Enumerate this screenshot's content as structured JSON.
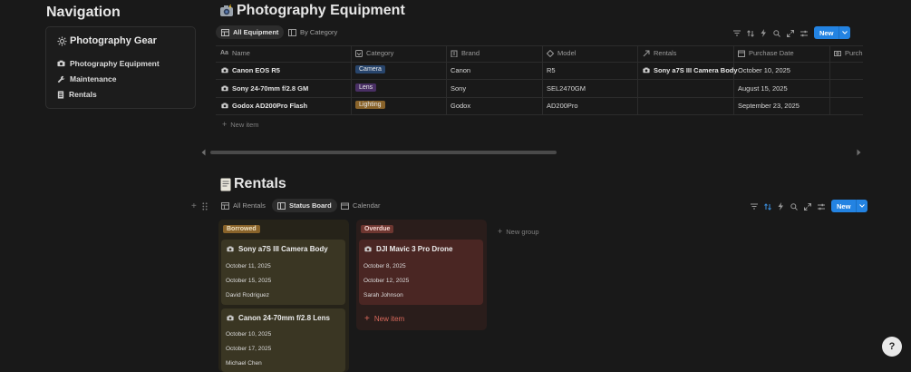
{
  "navigation": {
    "title": "Navigation",
    "card_title": "Photography Gear",
    "items": [
      {
        "label": "Photography Equipment",
        "icon": "camera-icon"
      },
      {
        "label": "Maintenance",
        "icon": "wrench-icon"
      },
      {
        "label": "Rentals",
        "icon": "receipt-icon"
      }
    ]
  },
  "equipment": {
    "title": "Photography Equipment",
    "tabs": [
      "All Equipment",
      "By Category"
    ],
    "new_label": "New",
    "columns": [
      "Name",
      "Category",
      "Brand",
      "Model",
      "Rentals",
      "Purchase Date",
      "Purcha"
    ],
    "rows": [
      {
        "name": "Canon EOS R5",
        "category": "Camera",
        "category_color": "#28456c",
        "brand": "Canon",
        "model": "R5",
        "rentals": "Sony a7S III Camera Body",
        "purchase_date": "October 10, 2025"
      },
      {
        "name": "Sony 24-70mm f/2.8 GM",
        "category": "Lens",
        "category_color": "#492f64",
        "brand": "Sony",
        "model": "SEL2470GM",
        "rentals": "",
        "purchase_date": "August 15, 2025"
      },
      {
        "name": "Godox AD200Pro Flash",
        "category": "Lighting",
        "category_color": "#89632a",
        "brand": "Godox",
        "model": "AD200Pro",
        "rentals": "",
        "purchase_date": "September 23, 2025"
      }
    ],
    "new_item_label": "New item"
  },
  "rentals": {
    "title": "Rentals",
    "tabs": [
      "All Rentals",
      "Status Board",
      "Calendar"
    ],
    "new_label": "New",
    "groups": [
      {
        "name": "Borrowed",
        "color": "#89632a",
        "cards": [
          {
            "title": "Sony a7S III Camera Body",
            "start": "October 11, 2025",
            "end": "October 15, 2025",
            "person": "David Rodriguez"
          },
          {
            "title": "Canon 24-70mm f/2.8 Lens",
            "start": "October 10, 2025",
            "end": "October 17, 2025",
            "person": "Michael Chen"
          }
        ]
      },
      {
        "name": "Overdue",
        "color": "#6e3630",
        "cards": [
          {
            "title": "DJI Mavic 3 Pro Drone",
            "start": "October 8, 2025",
            "end": "October 12, 2025",
            "person": "Sarah Johnson"
          }
        ],
        "new_item_label": "New item"
      }
    ],
    "new_group_label": "New group"
  },
  "help_label": "?"
}
